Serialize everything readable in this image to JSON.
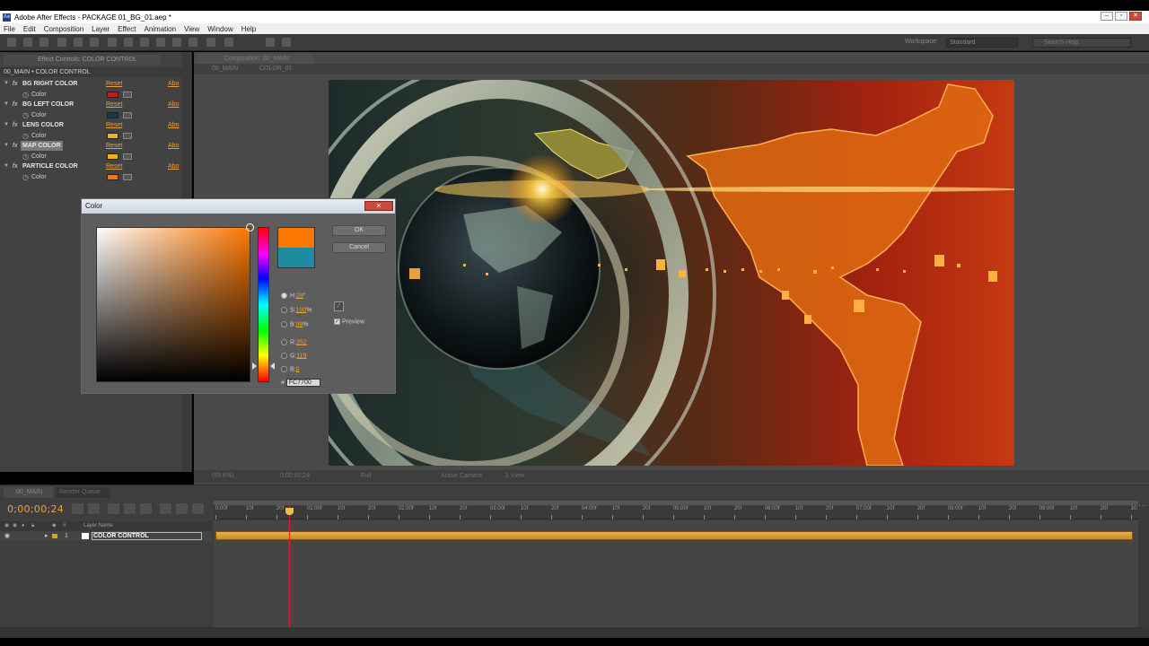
{
  "window": {
    "title": "Adobe After Effects - PACKAGE 01_BG_01.aep *",
    "app_icon": "Ae"
  },
  "window_buttons": {
    "minimize": "–",
    "maximize": "▫",
    "close": "✕"
  },
  "menu": [
    "File",
    "Edit",
    "Composition",
    "Layer",
    "Effect",
    "Animation",
    "View",
    "Window",
    "Help"
  ],
  "toolbar": {
    "workspace_label": "Workspace:",
    "workspace_value": "Standard",
    "search_placeholder": "Search Help"
  },
  "effect_controls": {
    "tab_label": "Effect Controls: COLOR CONTROL",
    "header": "00_MAIN • COLOR CONTROL",
    "reset_label": "Reset",
    "about_label": "Abo",
    "color_label": "Color",
    "effects": [
      {
        "name": "BG RIGHT COLOR",
        "swatch": "#e01010",
        "selected": false
      },
      {
        "name": "BG LEFT COLOR",
        "swatch": "#123a52",
        "selected": false
      },
      {
        "name": "LENS COLOR",
        "swatch": "#f0b020",
        "selected": false
      },
      {
        "name": "MAP COLOR",
        "swatch": "#f0b020",
        "selected": true
      },
      {
        "name": "PARTICLE COLOR",
        "swatch": "#fc7700",
        "selected": false
      }
    ]
  },
  "composition": {
    "tab_label": "Composition: 00_MAIN",
    "crumbs": [
      "00_MAIN",
      "COLOR_01"
    ],
    "footer": {
      "zoom": "(59.6%)",
      "timecode": "0;00;00;24",
      "resolution": "Full",
      "camera": "Active Camera",
      "views": "1 View"
    }
  },
  "color_dialog": {
    "title": "Color",
    "ok": "OK",
    "cancel": "Cancel",
    "new_color": "#fc7700",
    "old_color": "#1e8ca0",
    "fields": [
      {
        "label": "H:",
        "value": "28",
        "unit": "°",
        "selected": true
      },
      {
        "label": "S:",
        "value": "100",
        "unit": "%",
        "selected": false
      },
      {
        "label": "B:",
        "value": "99",
        "unit": "%",
        "selected": false
      },
      {
        "label": "R:",
        "value": "252",
        "unit": "",
        "selected": false
      },
      {
        "label": "G:",
        "value": "119",
        "unit": "",
        "selected": false
      },
      {
        "label": "B:",
        "value": "0",
        "unit": "",
        "selected": false
      }
    ],
    "hex_label": "#",
    "hex": "FC7700",
    "preview_label": "Preview",
    "preview_checked": true
  },
  "timeline": {
    "tab_label": "00_MAIN",
    "tab2_label": "Render Queue",
    "current_time": "0;00;00;24",
    "layer_header": "Layer Name",
    "layers": [
      {
        "number": "1",
        "name": "COLOR CONTROL",
        "label_color": "#e0a024"
      }
    ],
    "ruler_labels": [
      "0:00f",
      "10f",
      "20f",
      "01:00f",
      "10f",
      "20f",
      "02:00f",
      "10f",
      "20f",
      "03:00f",
      "10f",
      "20f",
      "04:00f",
      "10f",
      "20f",
      "05:00f",
      "10f",
      "20f",
      "06:00f",
      "10f",
      "20f",
      "07:00f",
      "10f",
      "20f",
      "08:00f",
      "10f",
      "20f",
      "09:00f",
      "10f",
      "20f",
      "10:00f"
    ]
  }
}
